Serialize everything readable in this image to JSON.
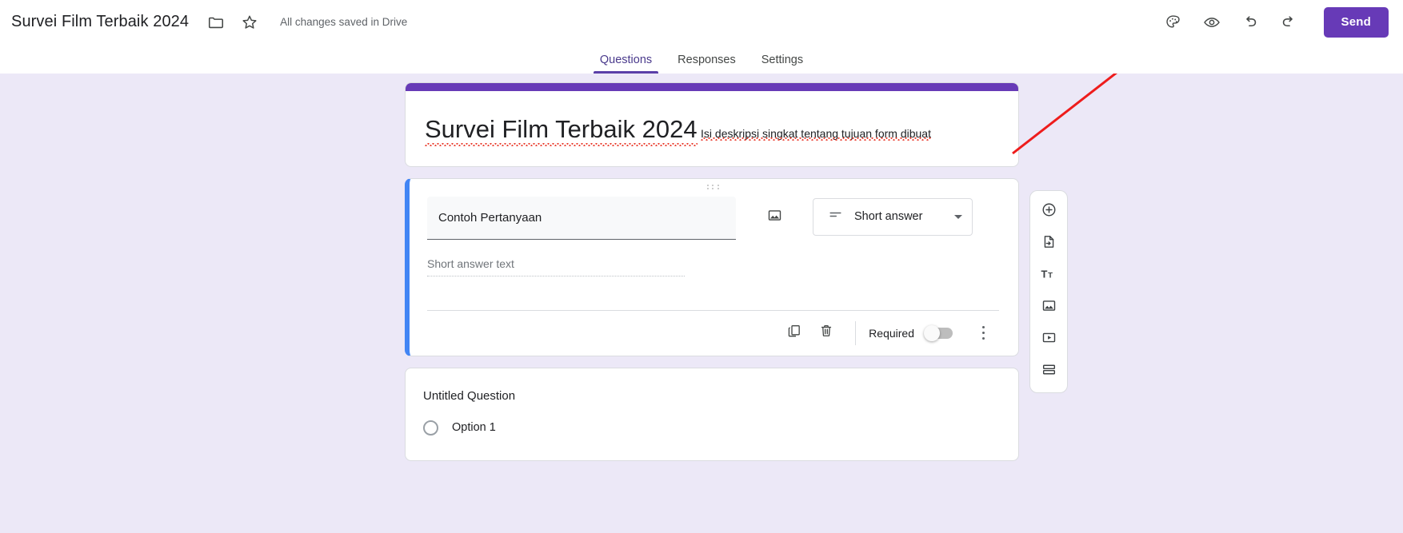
{
  "topbar": {
    "form_title": "Survei Film Terbaik 2024",
    "folder_icon": "folder-icon",
    "star_icon": "star-icon",
    "save_status": "All changes saved in Drive",
    "theme_icon": "palette-icon",
    "preview_icon": "eye-icon",
    "undo_icon": "undo-icon",
    "redo_icon": "redo-icon",
    "send_label": "Send",
    "accent_color": "#673ab7"
  },
  "tabs": [
    {
      "label": "Questions",
      "active": true
    },
    {
      "label": "Responses",
      "active": false
    },
    {
      "label": "Settings",
      "active": false
    }
  ],
  "form_header": {
    "title": "Survei Film Terbaik 2024",
    "description": "Isi deskripsi singkat tentang tujuan form dibuat",
    "stripe_color": "#673ab7"
  },
  "question_card": {
    "accent_color": "#4285f4",
    "drag_handle": "drag-handle-icon",
    "question_text": "Contoh Pertanyaan",
    "add_image_icon": "image-icon",
    "type_icon": "short-answer-icon",
    "type_label": "Short answer",
    "answer_placeholder": "Short answer text",
    "duplicate_icon": "duplicate-icon",
    "delete_icon": "trash-icon",
    "required_label": "Required",
    "required_on": false,
    "more_icon": "more-vert-icon"
  },
  "untitled_card": {
    "title": "Untitled Question",
    "option_label": "Option 1",
    "radio_icon": "radio-unchecked-icon"
  },
  "side_toolbar": [
    {
      "name": "add-question-button",
      "icon": "plus-circle-icon"
    },
    {
      "name": "import-questions-button",
      "icon": "import-file-icon"
    },
    {
      "name": "add-title-description-button",
      "icon": "title-text-icon"
    },
    {
      "name": "add-image-button",
      "icon": "image-icon"
    },
    {
      "name": "add-video-button",
      "icon": "video-icon"
    },
    {
      "name": "add-section-button",
      "icon": "section-icon"
    }
  ],
  "annotation": {
    "arrow_color": "#ee1c1c",
    "points_to": "Send"
  }
}
